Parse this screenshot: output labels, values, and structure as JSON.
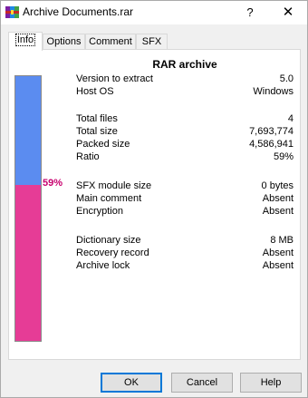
{
  "window": {
    "title": "Archive Documents.rar",
    "help_label": "?",
    "close_label": "✕",
    "app_icon": "winrar-books-icon"
  },
  "tabs": [
    {
      "label": "Info",
      "active": true
    },
    {
      "label": "Options",
      "active": false
    },
    {
      "label": "Comment",
      "active": false
    },
    {
      "label": "SFX",
      "active": false
    }
  ],
  "info": {
    "heading": "RAR archive",
    "ratio_percent_label": "59%",
    "ratio_fraction": 0.59,
    "colors": {
      "bar_top": "#5b8cf0",
      "bar_bottom": "#e63c96",
      "ratio_text": "#c8006e"
    },
    "rows": {
      "version_to_extract": {
        "label": "Version to extract",
        "value": "5.0"
      },
      "host_os": {
        "label": "Host OS",
        "value": "Windows"
      },
      "total_files": {
        "label": "Total files",
        "value": "4"
      },
      "total_size": {
        "label": "Total size",
        "value": "7,693,774"
      },
      "packed_size": {
        "label": "Packed size",
        "value": "4,586,941"
      },
      "ratio": {
        "label": "Ratio",
        "value": "59%"
      },
      "sfx_module_size": {
        "label": "SFX module size",
        "value": "0 bytes"
      },
      "main_comment": {
        "label": "Main comment",
        "value": "Absent"
      },
      "encryption": {
        "label": "Encryption",
        "value": "Absent"
      },
      "dictionary_size": {
        "label": "Dictionary size",
        "value": "8 MB"
      },
      "recovery_record": {
        "label": "Recovery record",
        "value": "Absent"
      },
      "archive_lock": {
        "label": "Archive lock",
        "value": "Absent"
      }
    }
  },
  "buttons": {
    "ok": "OK",
    "cancel": "Cancel",
    "help": "Help"
  }
}
